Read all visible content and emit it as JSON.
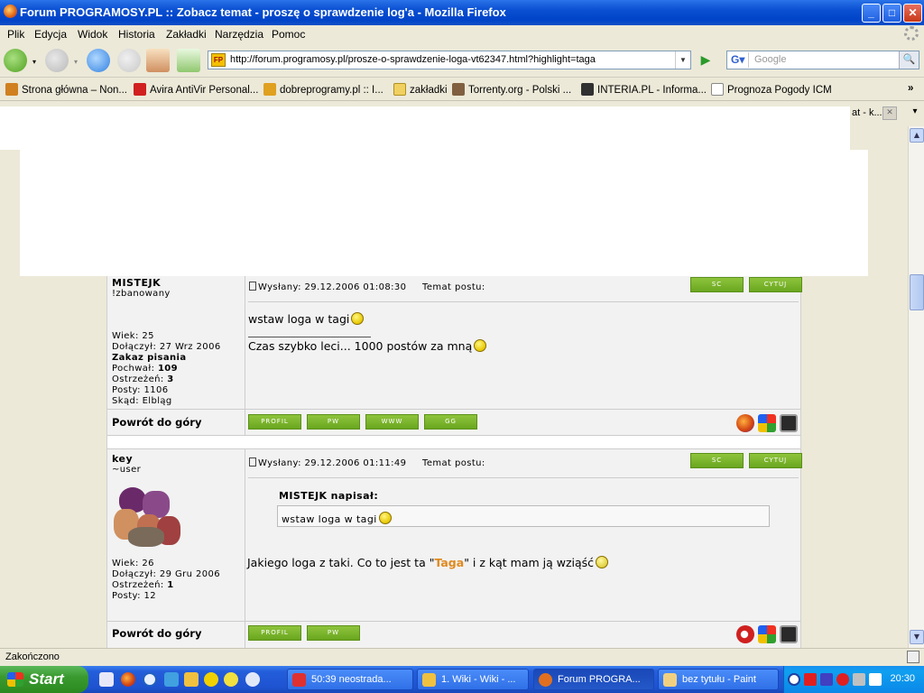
{
  "window": {
    "title": "Forum PROGRAMOSY.PL :: Zobacz temat - proszę o sprawdzenie log'a - Mozilla Firefox",
    "btn_min": "_",
    "btn_max": "□",
    "btn_close": "✕"
  },
  "menu": [
    "Plik",
    "Edycja",
    "Widok",
    "Historia",
    "Zakładki",
    "Narzędzia",
    "Pomoc"
  ],
  "nav": {
    "url": "http://forum.programosy.pl/prosze-o-sprawdzenie-loga-vt62347.html?highlight=taga",
    "favicon_text": "FP",
    "search_placeholder": "Google",
    "search_engine_label": "G▾"
  },
  "bookmarks": [
    {
      "label": "Strona główna – Non...",
      "color": "#d08020"
    },
    {
      "label": "Avira AntiVir Personal...",
      "color": "#d02020"
    },
    {
      "label": "dobreprogramy.pl :: I...",
      "color": "#e0a020"
    },
    {
      "label": "zakładki",
      "color": "#f0d060"
    },
    {
      "label": "Torrenty.org - Polski ...",
      "color": "#806040"
    },
    {
      "label": "INTERIA.PL - Informa...",
      "color": "#303030"
    },
    {
      "label": "Prognoza Pogody ICM",
      "color": "#ffffff"
    }
  ],
  "bookmarks_more": "»",
  "tabs": {
    "partial_title": "at - k...",
    "close": "✕",
    "list": "▾"
  },
  "posts": [
    {
      "author": "MISTEJK",
      "rank": "!zbanowany",
      "details": [
        {
          "label": "Wiek:",
          "value": "25",
          "bold": false
        },
        {
          "label": "Dołączył:",
          "value": "27 Wrz 2006",
          "bold": false
        },
        {
          "label": "Zakaz pisania",
          "value": "",
          "bold": true
        },
        {
          "label": "Pochwał:",
          "value": "109",
          "bold": "value"
        },
        {
          "label": "Ostrzeżeń:",
          "value": "3",
          "bold": "value"
        },
        {
          "label": "Posty:",
          "value": "1106",
          "bold": false
        },
        {
          "label": "Skąd:",
          "value": "Elbląg",
          "bold": false
        }
      ],
      "sent_label": "Wysłany: 29.12.2006 01:08:30",
      "subject_label": "Temat postu:",
      "body": "wstaw loga w tagi",
      "signature": "Czas szybko leci... 1000 postów za mną",
      "back_to_top": "Powrót do góry",
      "buttons": [
        "PROFIL",
        "PW",
        "WWW",
        "GG"
      ]
    },
    {
      "author": "key",
      "rank": "~user",
      "details": [
        {
          "label": "Wiek:",
          "value": "26",
          "bold": false
        },
        {
          "label": "Dołączył:",
          "value": "29 Gru 2006",
          "bold": false
        },
        {
          "label": "Ostrzeżeń:",
          "value": "1",
          "bold": "value"
        },
        {
          "label": "Posty:",
          "value": "12",
          "bold": false
        }
      ],
      "sent_label": "Wysłany: 29.12.2006 01:11:49",
      "subject_label": "Temat postu:",
      "quote_author": "MISTEJK napisał:",
      "quote_text": "wstaw loga w tagi",
      "body_before": "Jakiego loga z taki. Co to jest ta \"",
      "body_highlight": "Taga",
      "body_after": "\" i z kąt mam ją wziąść",
      "back_to_top": "Powrót do góry",
      "buttons": [
        "PROFIL",
        "PW"
      ]
    }
  ],
  "post_actions": [
    "SC",
    "CYTUJ"
  ],
  "status": "Zakończono",
  "taskbar": {
    "start": "Start",
    "tasks": [
      {
        "label": "50:39 neostrada...",
        "color": "#e03030"
      },
      {
        "label": "1. Wiki - Wiki - ...",
        "color": "#f0c040"
      },
      {
        "label": "Forum PROGRA...",
        "color": "#e07020",
        "active": true
      },
      {
        "label": "bez tytułu - Paint",
        "color": "#f0d080"
      }
    ],
    "clock": "20:30"
  },
  "colors": {
    "accent_green": "#7ab52c",
    "highlight_orange": "#e08a20",
    "xp_blue": "#245edb"
  }
}
